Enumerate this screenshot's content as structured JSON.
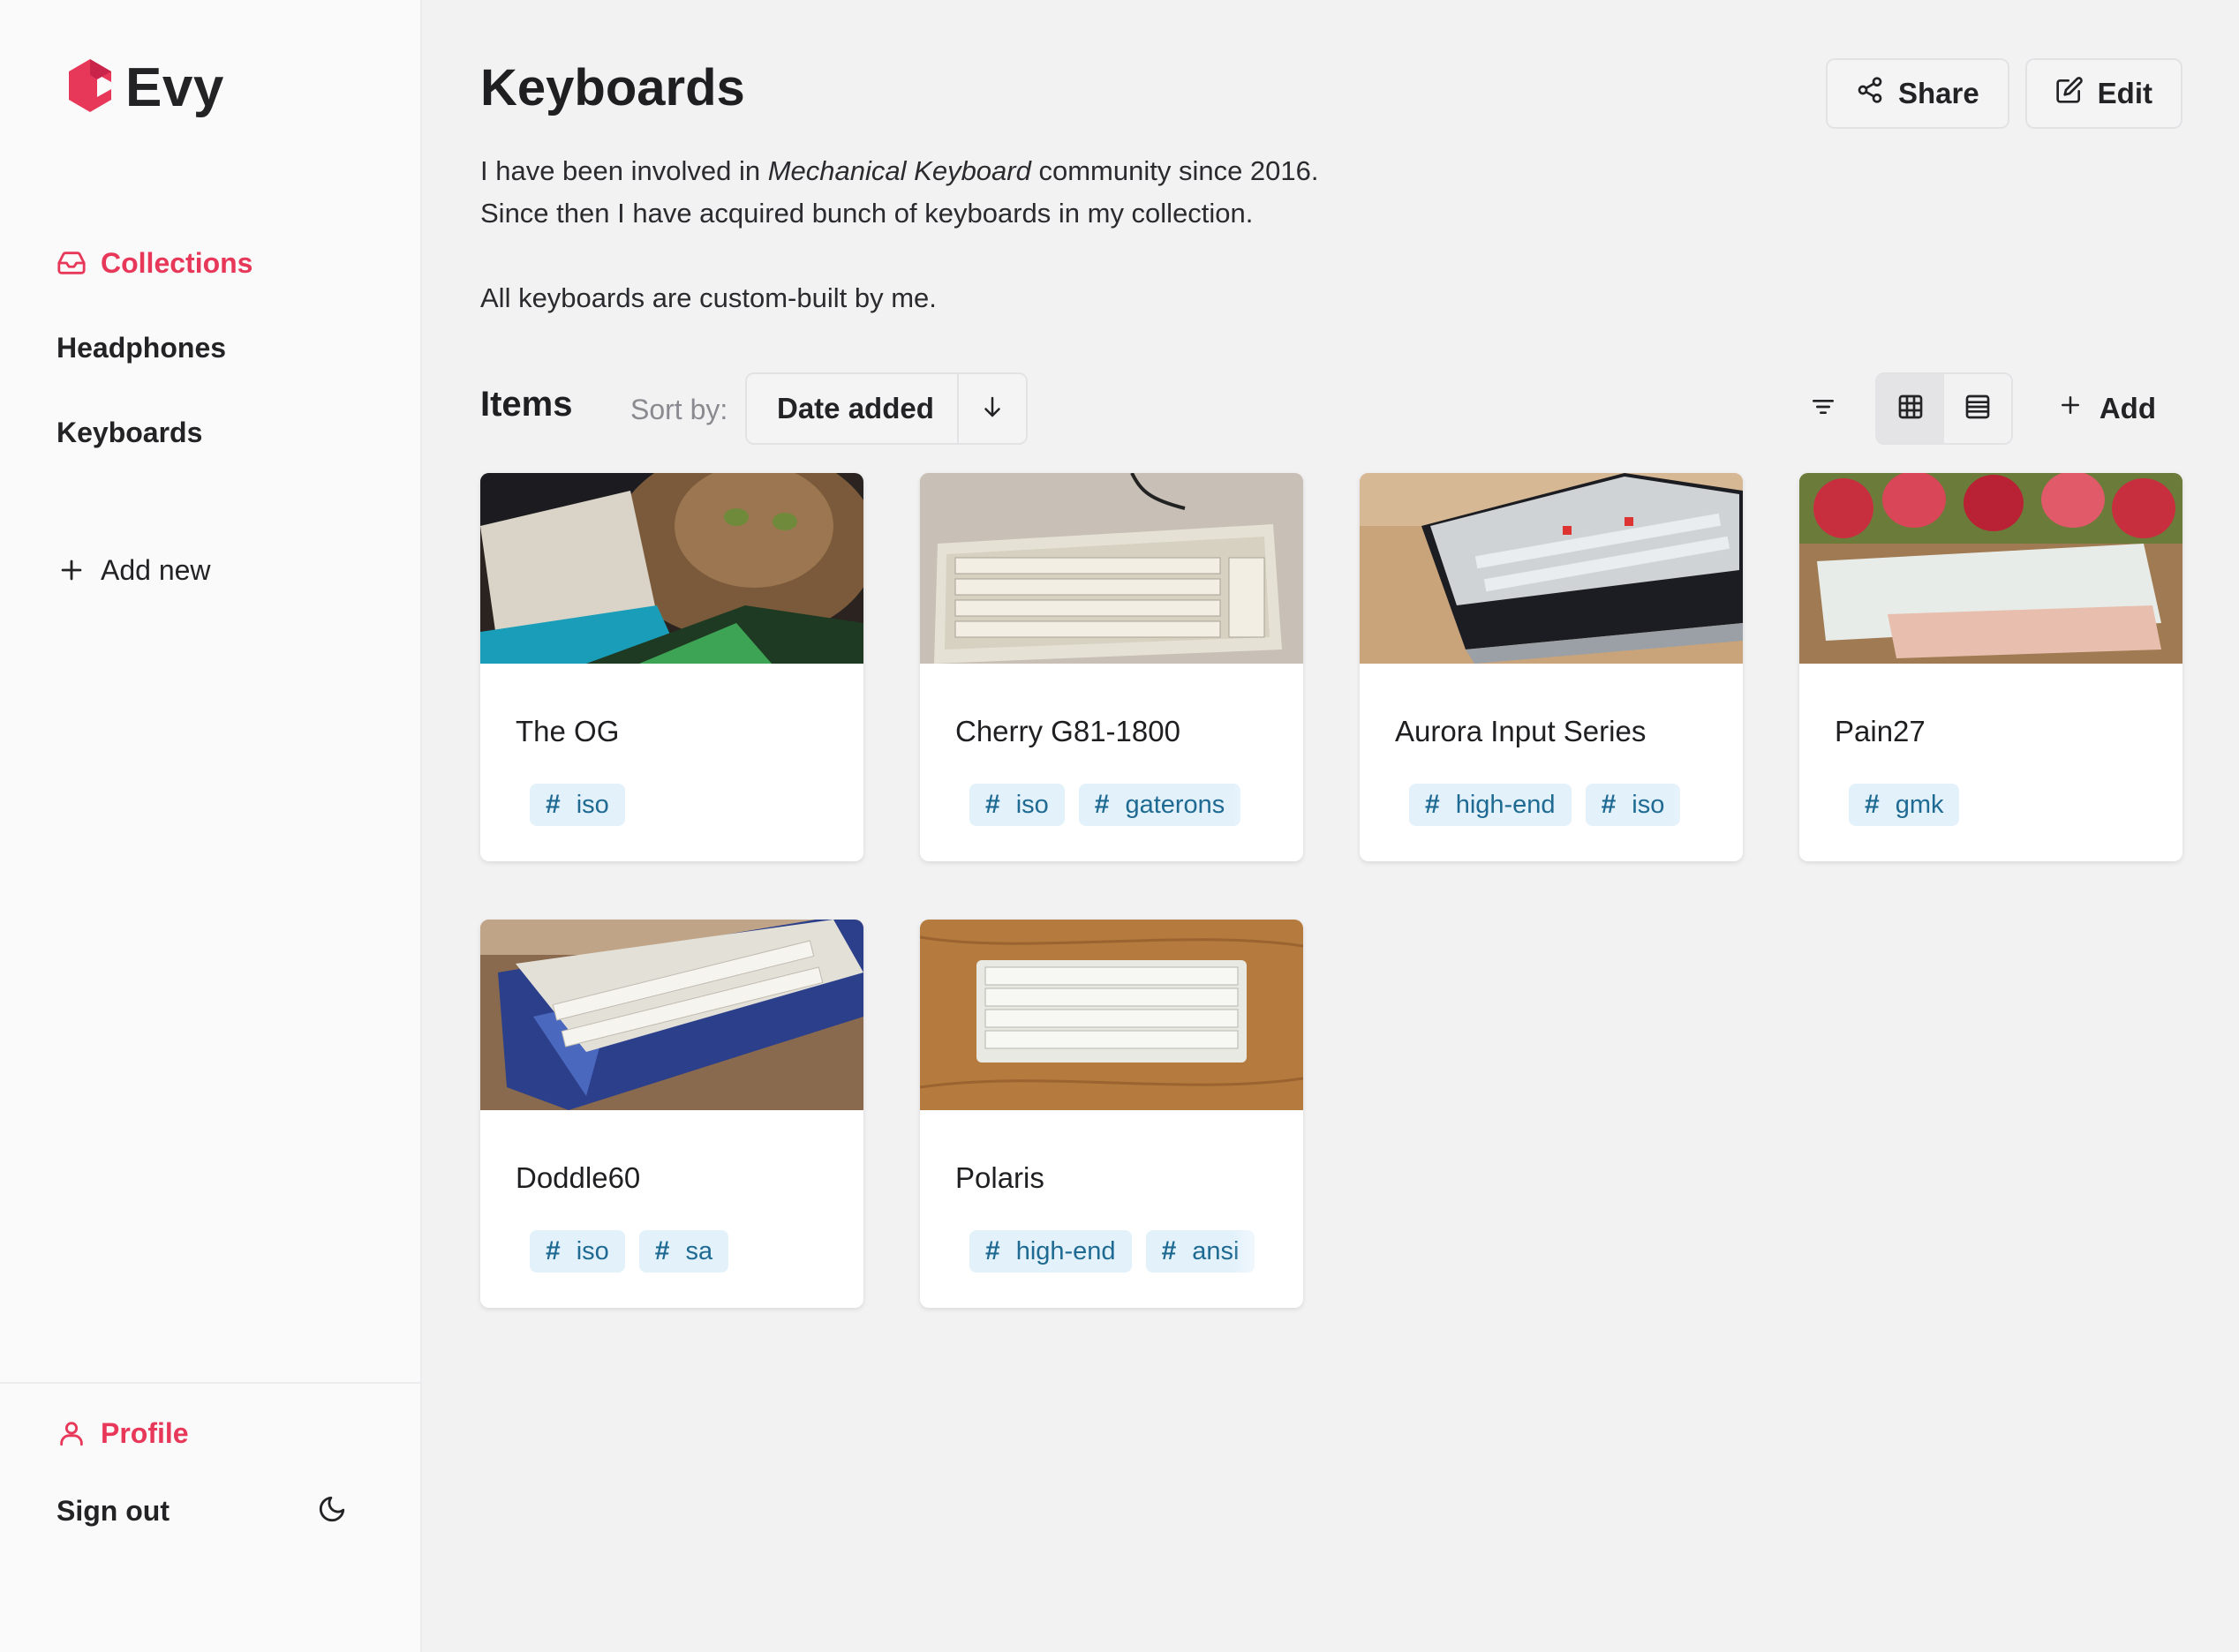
{
  "app": {
    "name": "Evy",
    "brand_color": "#e8385a"
  },
  "sidebar": {
    "items": [
      {
        "label": "Collections",
        "icon": "inbox-icon",
        "active": true
      },
      {
        "label": "Headphones",
        "icon": "",
        "active": false
      },
      {
        "label": "Keyboards",
        "icon": "",
        "active": false
      }
    ],
    "add_new": "Add new",
    "profile": "Profile",
    "sign_out": "Sign out",
    "theme_icon": "moon-icon"
  },
  "page": {
    "title": "Keyboards",
    "share_label": "Share",
    "edit_label": "Edit",
    "description": {
      "line1_before": "I have been involved in ",
      "line1_em": "Mechanical Keyboard",
      "line1_after": " community since 2016.",
      "line2": "Since then I have acquired bunch of keyboards in my collection.",
      "line3": "All keyboards are custom-built by me."
    }
  },
  "items_bar": {
    "title": "Items",
    "sort_label": "Sort by:",
    "sort_value": "Date added",
    "sort_direction": "descending",
    "view_mode": "grid",
    "add_label": "Add"
  },
  "cards": [
    {
      "title": "The OG",
      "tags": [
        "iso"
      ]
    },
    {
      "title": "Cherry G81-1800",
      "tags": [
        "iso",
        "gaterons"
      ]
    },
    {
      "title": "Aurora Input Series",
      "tags": [
        "high-end",
        "iso"
      ]
    },
    {
      "title": "Pain27",
      "tags": [
        "gmk"
      ]
    },
    {
      "title": "Doddle60",
      "tags": [
        "iso",
        "sa"
      ]
    },
    {
      "title": "Polaris",
      "tags": [
        "high-end",
        "ansi"
      ]
    }
  ],
  "colors": {
    "tag_bg": "#e3f1fb",
    "tag_text": "#1e6a92",
    "accent": "#e8385a"
  }
}
